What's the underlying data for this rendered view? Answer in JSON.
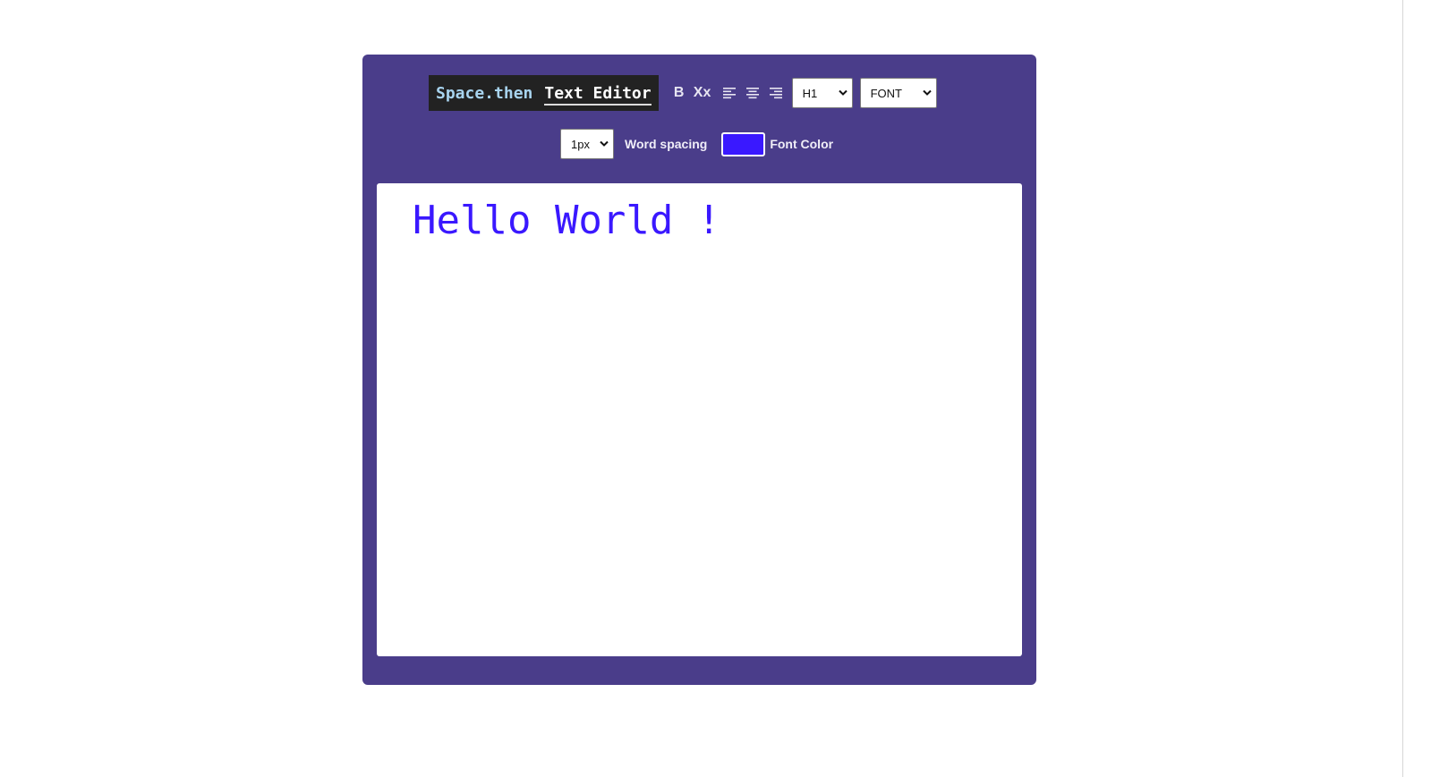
{
  "toolbar": {
    "brand_part1": "Space.then",
    "brand_part2": "Text Editor",
    "bold_label": "B",
    "subscript_label": "Xx",
    "align_icons": [
      "align-left-icon",
      "align-center-icon",
      "align-right-icon"
    ],
    "heading_select": {
      "selected": "H1"
    },
    "font_select": {
      "selected": "FONT"
    },
    "word_spacing_select": {
      "selected": "1px"
    },
    "word_spacing_label": "Word spacing",
    "font_color_label": "Font Color",
    "font_color_value": "#3a18ff"
  },
  "editor": {
    "content": "Hello World !"
  },
  "colors": {
    "card_background": "#4a3d8a",
    "brand_background": "#222222",
    "brand_accent": "#a8d4ef",
    "text_color": "#3a18ff"
  }
}
